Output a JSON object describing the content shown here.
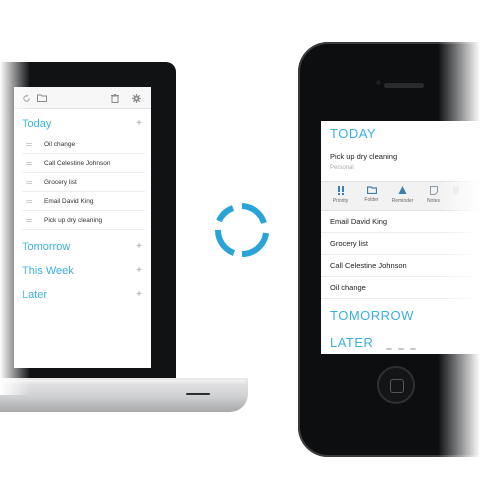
{
  "laptop": {
    "sections": [
      {
        "label": "Today",
        "items": [
          "Oil change",
          "Call Celestine Johnson",
          "Grocery list",
          "Email David King",
          "Pick up dry cleaning"
        ]
      },
      {
        "label": "Tomorrow",
        "items": []
      },
      {
        "label": "This Week",
        "items": []
      },
      {
        "label": "Later",
        "items": []
      }
    ],
    "plus": "+"
  },
  "phone": {
    "today_label": "TODAY",
    "expanded_item": {
      "title": "Pick up dry cleaning",
      "list": "Personal"
    },
    "actions": [
      {
        "label": "Priority",
        "icon": "priority-icon"
      },
      {
        "label": "Folder",
        "icon": "folder-icon"
      },
      {
        "label": "Reminder",
        "icon": "reminder-icon"
      },
      {
        "label": "Notes",
        "icon": "notes-icon"
      }
    ],
    "items": [
      "Email David King",
      "Grocery list",
      "Call Celestine Johnson",
      "Oil change"
    ],
    "tomorrow_label": "TOMORROW",
    "later_label": "LATER"
  },
  "colors": {
    "accent": "#3bb0e0",
    "sync": "#2aa4d8"
  }
}
